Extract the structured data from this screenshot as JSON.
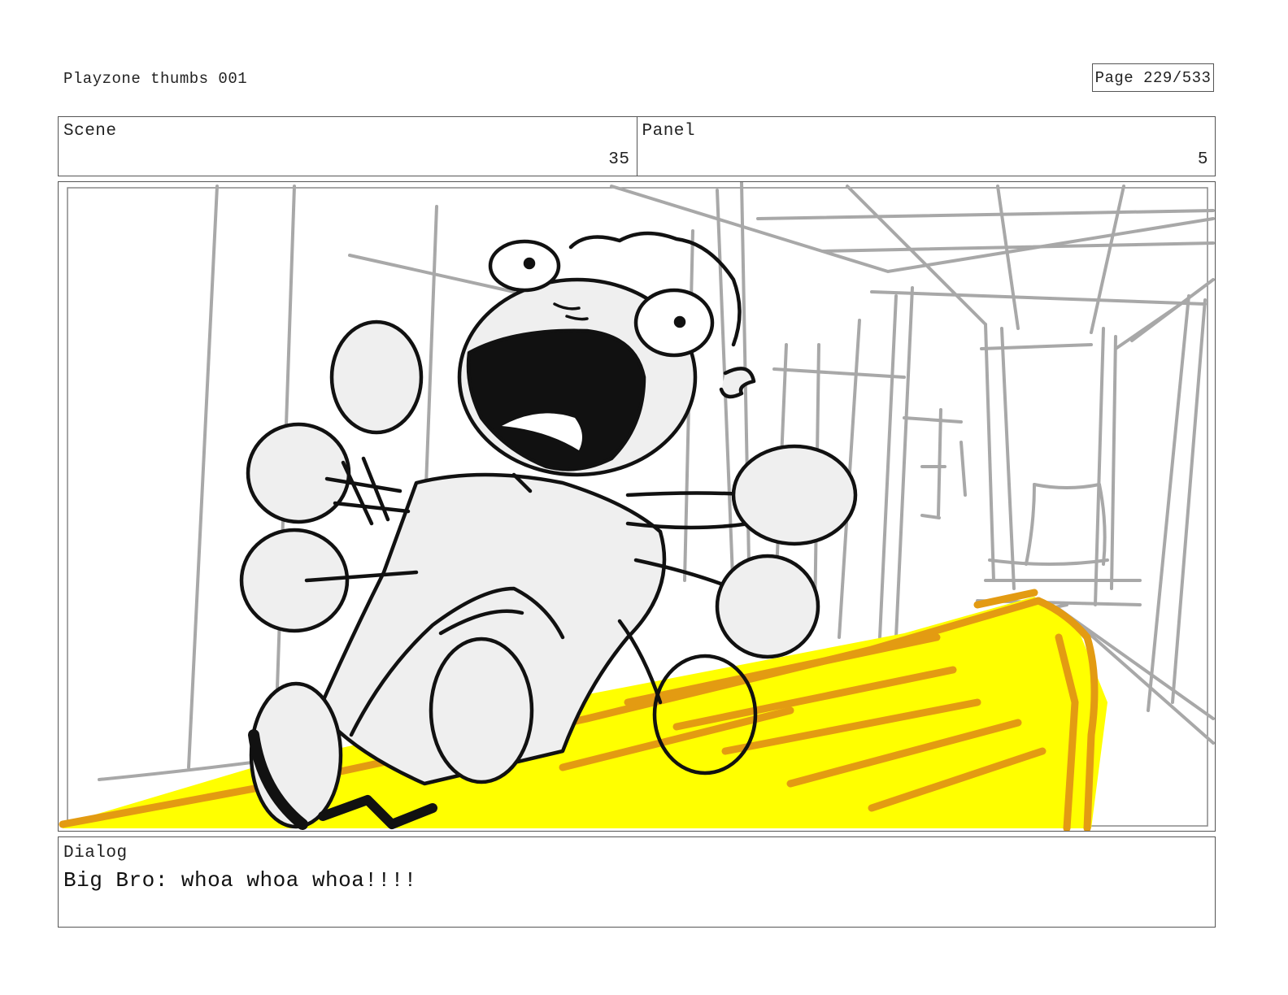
{
  "document": {
    "title": "Playzone thumbs 001",
    "page": "Page 229/533"
  },
  "scene": {
    "label": "Scene",
    "value": "35"
  },
  "panel": {
    "label": "Panel",
    "value": "5"
  },
  "frame": {
    "image": "storyboard-sketch-kid-sliding-down-yellow-slide-in-hallway"
  },
  "dialog": {
    "label": "Dialog",
    "text": "Big Bro: whoa whoa whoa!!!!"
  },
  "colors": {
    "slide_yellow": "#ffff00",
    "slide_orange": "#e39b12",
    "background_lines": "#a8a8a8",
    "ink": "#111111"
  }
}
